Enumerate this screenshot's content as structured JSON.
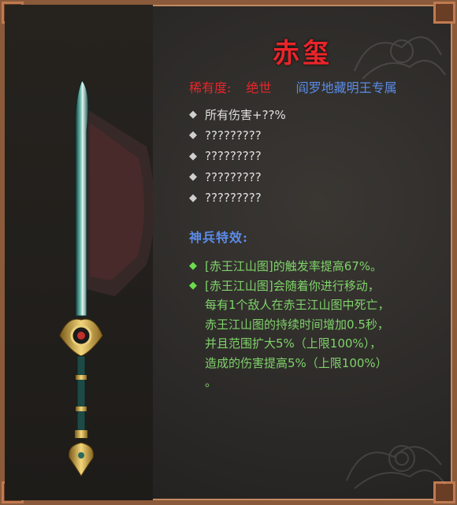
{
  "item": {
    "name": "赤玺",
    "rarity_label": "稀有度:",
    "rarity_value": "绝世",
    "exclusive": "阎罗地藏明王专属"
  },
  "stats": [
    "所有伤害+??%",
    "?????????",
    "?????????",
    "?????????",
    "?????????"
  ],
  "special": {
    "title": "神兵特效:",
    "effects": [
      {
        "lines": [
          "[赤王江山图]的触发率提高67%。"
        ]
      },
      {
        "lines": [
          "[赤王江山图]会随着你进行移动，",
          "每有1个敌人在赤王江山图中死亡，",
          "赤王江山图的持续时间增加0.5秒，",
          "并且范围扩大5%（上限100%），",
          "造成的伤害提高5%（上限100%）",
          "。"
        ]
      }
    ]
  },
  "icons": {
    "bullet": "diamond-icon",
    "weapon": "sword-icon"
  },
  "colors": {
    "title": "#e8252a",
    "exclusive": "#5b8ce8",
    "effect_text": "#7fd36a",
    "stat_text": "#e0e0e0",
    "frame": "#8a5a3a"
  }
}
